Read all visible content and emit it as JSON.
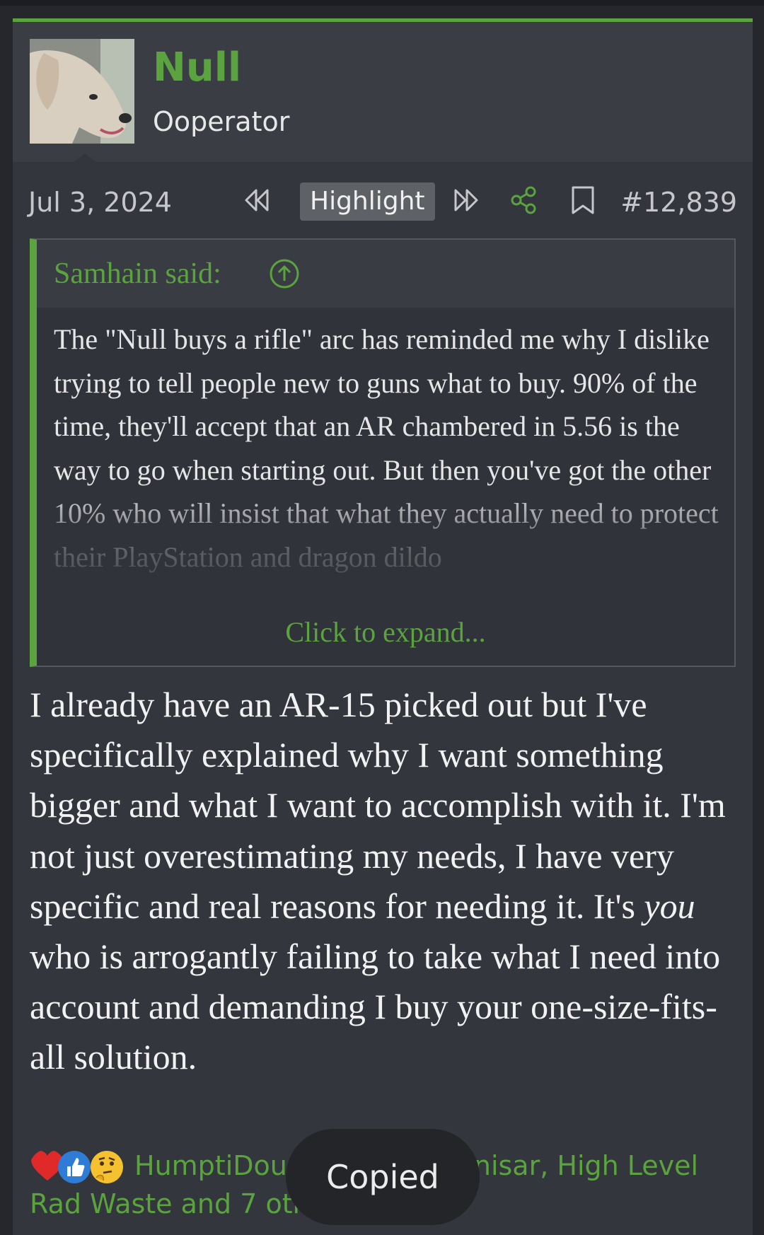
{
  "post": {
    "username": "Null",
    "user_title": "Ooperator",
    "date": "Jul 3, 2024",
    "highlight_label": "Highlight",
    "post_number": "#12,839",
    "icons": {
      "prev": "rewind-icon",
      "next": "fast-forward-icon",
      "share": "share-icon",
      "bookmark": "bookmark-icon",
      "quote_jump": "arrow-up-circle-icon"
    }
  },
  "quote": {
    "author_label": "Samhain said:",
    "text": "The \"Null buys a rifle\" arc has reminded me why I dislike trying to tell people new to guns what to buy. 90% of the time, they'll accept that an AR chambered in 5.56 is the way to go when starting out. But then you've got the other 10% who will insist that what they actually need to protect their PlayStation and dragon dildo",
    "expand_label": "Click to expand..."
  },
  "message": {
    "part1": "I already have an AR-15 picked out but I've specifically explained why I want something bigger and what I want to accomplish with it. I'm not just overestimating my needs, I have very specific and real reasons for needing it. It's ",
    "emphasis": "you",
    "part2": " who is arrogantly failing to take what I need into account and demanding I buy your one-size-fits-all solution."
  },
  "reactions": {
    "icons": [
      "heart-icon",
      "thumbs-up-icon",
      "thinking-icon"
    ],
    "line1_left": "HumptiDou",
    "line1_right": "nisar, High Level",
    "line2": "Rad Waste and 7 oth"
  },
  "toast": {
    "label": "Copied"
  },
  "colors": {
    "accent": "#5aa33e",
    "background": "#25272c",
    "post_bg": "#33363d"
  }
}
